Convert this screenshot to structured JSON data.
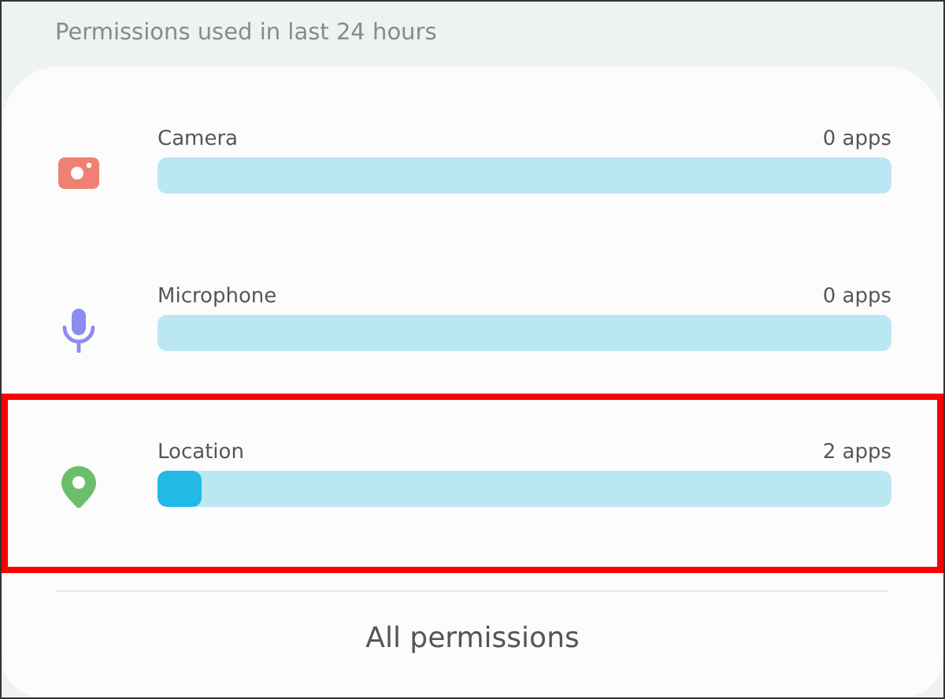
{
  "header": "Permissions used in last 24 hours",
  "permissions": [
    {
      "kind": "camera",
      "label": "Camera",
      "count": "0 apps",
      "color": "#ef8172",
      "highlighted": false
    },
    {
      "kind": "microphone",
      "label": "Microphone",
      "count": "0 apps",
      "color": "#8e8cf0",
      "highlighted": false
    },
    {
      "kind": "location",
      "label": "Location",
      "count": "2 apps",
      "level": 0.06,
      "color": "#6cbf6a",
      "highlighted": true
    }
  ],
  "all_button": "All permissions"
}
